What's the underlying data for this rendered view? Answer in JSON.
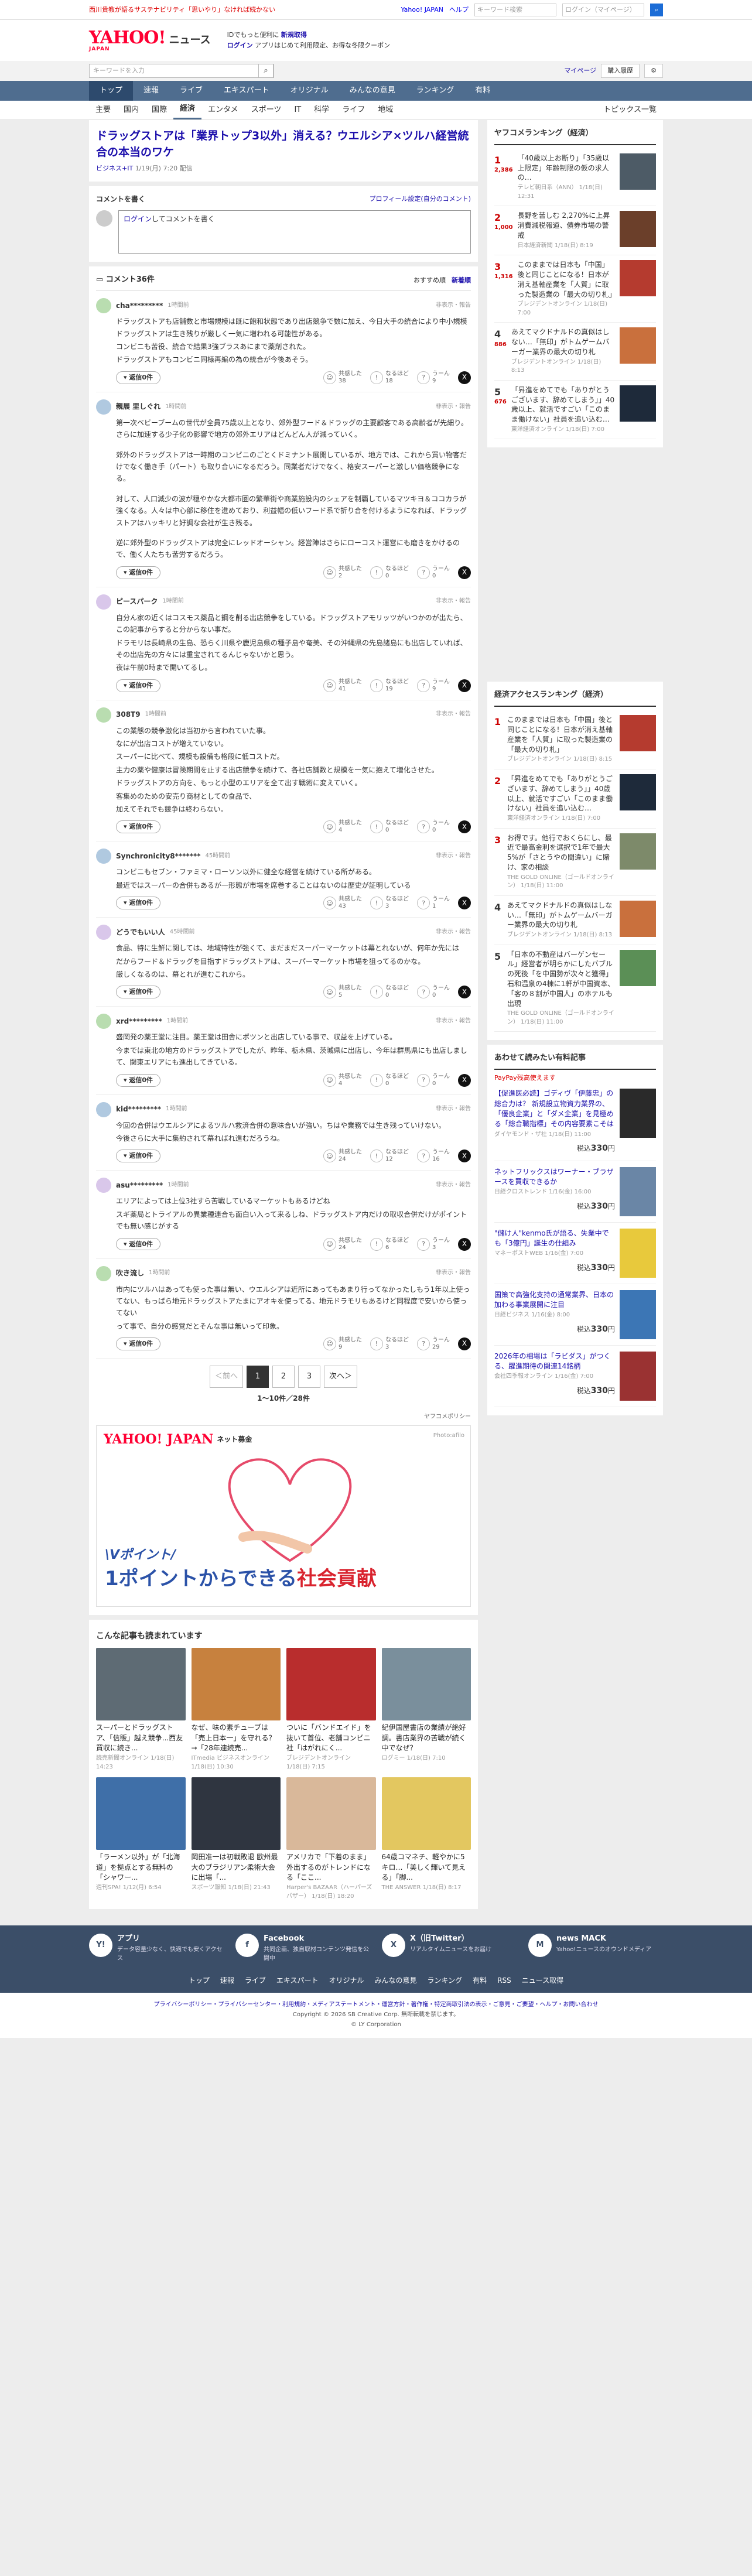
{
  "top": {
    "promo": "西川貴教が語るサステナビリティ「思いやり」なければ続かない",
    "jp": "Yahoo! JAPAN",
    "help": "ヘルプ",
    "search": "キーワード検索",
    "cw": "ログイン（マイページ）"
  },
  "header": {
    "logo": "YAHOO!",
    "logo_sub": "JAPAN",
    "news": "ニュース",
    "l1": "IDでもっと便利に",
    "l1b": "新規取得",
    "l2": "ログイン",
    "l2b": "アプリはじめて利用限定、お得な冬限クーポン"
  },
  "search": {
    "ph": "キーワードを入力",
    "mp": "マイページ",
    "buy": "購入履歴"
  },
  "nav1": [
    "トップ",
    "速報",
    "ライブ",
    "エキスパート",
    "オリジナル",
    "みんなの意見",
    "ランキング",
    "有料"
  ],
  "nav2": [
    "主要",
    "国内",
    "国際",
    "経済",
    "エンタメ",
    "スポーツ",
    "IT",
    "科学",
    "ライフ",
    "地域"
  ],
  "nav2_topics": "トピックス一覧",
  "article": {
    "title": "ドラッグストアは「業界トップ3以外」消える？ウエルシア×ツルハ経営統合の本当のワケ",
    "src": "ビジネス+IT",
    "date": "1/19(月) 7:20 配信"
  },
  "cwrite": {
    "h": "コメントを書く",
    "prof": "プロフィール設定(自分のコメント)",
    "login": "ログイン",
    "rest": "してコメントを書く"
  },
  "comments_h": {
    "title": "コメント36件",
    "rec": "おすすめ順",
    "new": "新着順"
  },
  "labels": {
    "reply": "返信0件",
    "report": "非表示・報告",
    "agree": "共感した",
    "insight": "なるほど",
    "doubt": "うーん"
  },
  "comments": [
    {
      "user": "cha*********",
      "time": "1時間前",
      "body": [
        "ドラッグストアも店舗数と市場規模は既に飽和状態であり出店競争で数に加え、今日大手の統合により中小規模ドラッグストアは生き残りが厳しく一気に増われる可能性がある。",
        "コンビニも苦役、統合で結果3強ブラスあにまで薬剤された。",
        "ドラッグストアもコンビニ同様再編の為の統合が今後あそう。"
      ],
      "a": "38",
      "b": "18",
      "c": "9"
    },
    {
      "user": "親展 里しぐれ",
      "time": "1時間前",
      "body": [
        "第一次ベビーブームの世代が全員75歳以上となり、郊外型フード＆ドラッグの主要顧客である高齢者が先細り。さらに加速する少子化の影響で地方の郊外エリアはどんどん人が減っていく。",
        "",
        "郊外のドラッグストアは一時期のコンビニのごとくドミナント展開しているが、地方では、これから買い物客だけでなく働き手（パート）も取り合いになるだろう。同業者だけでなく、格安スーパーと激しい価格競争になる。",
        "",
        "対して、人口減少の波が穏やかな大都市圏の繁華街や商業施設内のシェアを制覇しているマツキヨ＆ココカラが強くなる。人々は中心部に移住を進めており、利益幅の低いフード系で折り合を付けるようになれば、ドラッグストアはハッキリと好調な会社が生き残る。",
        "",
        "逆に郊外型のドラッグストアは完全にレッドオーシャン。経営陣はさらにローコスト運営にも磨きをかけるので、働く人たちも苦労するだろう。"
      ],
      "a": "2",
      "b": "0",
      "c": "0"
    },
    {
      "user": "ピースパーク",
      "time": "1時間前",
      "body": [
        "自分ん家の近くはコスモス薬品と鋼を削る出店競争をしている。ドラッグストアモリッツがいつかのが出たら、この記事からすると分からない事だ。",
        "ドラモリは長崎県の生島、恐らく川県や鹿児島県の種子島や奄美、その沖縄県の先島諸島にも出店していれば、その出店先の方々には重宝されてるんじゃないかと思う。",
        "夜は午前0時まで開いてるし。"
      ],
      "a": "41",
      "b": "19",
      "c": "9"
    },
    {
      "user": "308T9",
      "time": "1時間前",
      "body": [
        "この業態の競争激化は当初から言われていた事。",
        "なにが出店コストが増えていない。",
        "スーパーに比べて、規模も設備も格段に低コストだ。",
        "主力の薬や健康は冒険期間を止する出店競争を続けて、各社店舗数と規模を一気に抱えて増化させた。",
        "ドラッグストアの方向を、もっと小型のエリアを全て出す戦術に変えていく。",
        "客集めのための安売り商材としての食品で、",
        "加えてそれでも競争は終わらない。"
      ],
      "a": "4",
      "b": "0",
      "c": "0"
    },
    {
      "user": "Synchronicity8*******",
      "time": "45時間前",
      "body": [
        "コンビニもセブン・ファミマ・ローソン以外に健全な経営を続けている所がある。",
        "最近ではスーパーの合併もあるが一形態が市場を席巻することはないのは歴史が証明している"
      ],
      "a": "43",
      "b": "3",
      "c": "1"
    },
    {
      "user": "どうでもいい人",
      "time": "45時間前",
      "body": [
        "食品、特に生鮮に関しては、地域特性が強くて、まだまだスーパーマーケットは幕とれないが、何年か先には",
        "だからフード＆ドラッグを目指すドラッグストアは、スーパーマーケット市場を狙ってるのかな。",
        "厳しくなるのは、幕とれが進むこれから。"
      ],
      "a": "5",
      "b": "0",
      "c": "0"
    },
    {
      "user": "xrd*********",
      "time": "1時間前",
      "body": [
        "盛岡発の薬王堂に注目。薬王堂は田舎にポツンと出店している事で、収益を上げている。",
        "今までは東北の地方のドラッグストアでしたが、昨年、栃木県、茨城県に出店し、今年は群馬県にも出店しまして、関東エリアにも進出してきている。"
      ],
      "a": "4",
      "b": "0",
      "c": "0"
    },
    {
      "user": "kid*********",
      "time": "1時間前",
      "body": [
        "今回の合併はウエルシアによるツルハ救済合併の意味合いが強い。ちはや業務では生き残っていけない。",
        "今後さらに大手に集約されて幕ればれ進むだろうね。"
      ],
      "a": "24",
      "b": "12",
      "c": "16"
    },
    {
      "user": "asu*********",
      "time": "1時間前",
      "body": [
        "エリアによっては上位3社すら苦戦しているマーケットもあるけどね",
        "スギ薬局とトライアルの異業種連合も面白い入って来るしね、ドラッグストア内だけの取収合併だけがポイントでも無い感じがする"
      ],
      "a": "24",
      "b": "6",
      "c": "3"
    },
    {
      "user": "吹き流し",
      "time": "1時間前",
      "body": [
        "市内にツルハはあっても使った事は無い、ウエルシアは近所にあってもあまり行ってなかったしもう1年以上使ってない、もっぱら地元ドラッグストアたまにアオキを使ってる、地元ドラモリもあるけど同程度で安いから使ってない",
        "って事で、自分の感覚だとそんな事は無いって印象。"
      ],
      "a": "9",
      "b": "3",
      "c": "29"
    }
  ],
  "pager": {
    "prev": "＜前へ",
    "p": [
      "1",
      "2",
      "3"
    ],
    "next": "次へ＞",
    "count": "1〜10件／28件"
  },
  "sponsor": "ヤフコメポリシー",
  "ad": {
    "logo": "YAHOO! JAPAN",
    "sub": "ネット募金",
    "photo": "Photo:afilo",
    "t1": "\\Vポイント/",
    "t2a": "1ポイントからできる",
    "t2b": "社会貢献"
  },
  "related": {
    "h": "こんな記事も読まれています",
    "items": [
      {
        "t": "スーパーとドラッグストア、「信販」越え競争...西友買収に続き...",
        "s": "読売新聞オンライン 1/18(日) 14:23",
        "c": "#5e6b74"
      },
      {
        "t": "なぜ、味の素チューブは「売上日本一」を守れる？→「28年連続売...",
        "s": "ITmedia ビジネスオンライン 1/18(日) 10:30",
        "c": "#c7813e"
      },
      {
        "t": "ついに「バンドエイド」を抜いて首位、老舗コンビニ社「はがれにく...",
        "s": "ブレジデントオンライン 1/18(日) 7:15",
        "c": "#b92d2d"
      },
      {
        "t": "紀伊国屋書店の業績が絶好調。書店業界の苦戦が続く中でなぜ？",
        "s": "ログミー 1/18(日) 7:10",
        "c": "#7a8f9c"
      },
      {
        "t": "「ラーメン以外」が「北海道」を拠点とする無料の「シャワー...",
        "s": "週刊SPA! 1/12(月) 6:54",
        "c": "#3f6fa8"
      },
      {
        "t": "岡田准一は初戦敗退 欧州最大のブラジリアン柔術大会に出場「...",
        "s": "スポーツ報知 1/18(日) 21:43",
        "c": "#2f3540"
      },
      {
        "t": "アメリカで「下着のまま」外出するのがトレンドになる「ここ...",
        "s": "Harper's BAZAAR（ハーパーズ バザー） 1/18(日) 18:20",
        "c": "#d9b89a"
      },
      {
        "t": "64歳コマネチ、軽やかに5キロ…「美しく輝いて見える」「脚...",
        "s": "THE ANSWER 1/18(日) 8:17",
        "c": "#e3c760"
      }
    ]
  },
  "ranking": {
    "h": "ヤフコメランキング（経済）",
    "items": [
      {
        "n": "1",
        "t": "「40歳以上お断り」「35歳以上限定」年齢制限の仮の求人の…",
        "s": "テレビ朝日系（ANN） 1/18(日) 12:31",
        "pc": "2,386",
        "c": "#4d5b66"
      },
      {
        "n": "2",
        "t": "長野を苦しむ 2,270%に上昇 消費減税報道、債券市場の警戒",
        "s": "日本経済新聞 1/18(日) 8:19",
        "pc": "1,000",
        "c": "#6b3f2a"
      },
      {
        "n": "3",
        "t": "このままでは日本も「中国」後と同じことになる！日本が消え基軸産業を「人質」に取った製造業の「最大の切り札」",
        "s": "ブレジデントオンライン 1/18(日) 7:00",
        "pc": "1,316",
        "c": "#b53b2f"
      },
      {
        "n": "4",
        "t": "あえてマクドナルドの真似はしない…「無印」がトムゲームバーガー業界の最大の切り札",
        "s": "ブレジデントオンライン 1/18(日) 8:13",
        "pc": "886",
        "c": "#c9703d"
      },
      {
        "n": "5",
        "t": "「昇進をめてでも「ありがとうございます、辞めてしまう」」40歳以上、就活ですごい「このまま働けない」社員を追い込む…",
        "s": "東洋経済オンライン 1/18(日) 7:00",
        "pc": "676",
        "c": "#1e2a3a"
      }
    ]
  },
  "access": {
    "h": "経済アクセスランキング（経済）",
    "items": [
      {
        "n": "1",
        "t": "このままでは日本も「中国」後と同じことになる！日本が消え基軸産業を「人質」に取った製造業の「最大の切り札」",
        "s": "ブレジデントオンライン 1/18(日) 8:15",
        "c": "#b53b2f"
      },
      {
        "n": "2",
        "t": "「昇進をめてでも「ありがとうございます、辞めてしまう」」40歳以上、就活ですごい「このまま働けない」社員を追い込む…",
        "s": "東洋経済オンライン 1/18(日) 7:00",
        "c": "#1e2a3a"
      },
      {
        "n": "3",
        "t": "お得です。他行でおくらにし、最近で最高金利を選択で1年で最大5%が「さとうやの間違い」に賭け、家の相談",
        "s": "THE GOLD ONLINE（ゴールドオンライン） 1/18(日) 11:00",
        "c": "#7d8a6a"
      },
      {
        "n": "4",
        "t": "あえてマクドナルドの真似はしない…「無印」がトムゲームバーガー業界の最大の切り札",
        "s": "ブレジデントオンライン 1/18(日) 8:13",
        "c": "#c9703d"
      },
      {
        "n": "5",
        "t": "「日本の不動産はバーゲンセール」経営者が明らかにしたバブルの死後「を中国勢が次々と獲得」石和温泉の4棟に1軒が中国資本、「客の８割が中国人」のホテルも出現",
        "s": "THE GOLD ONLINE（ゴールドオンライン） 1/18(日) 11:00",
        "c": "#5b8f56"
      }
    ]
  },
  "magazine": {
    "h": "あわせて読みたい有料記事",
    "sub": "PayPay残高使えます",
    "items": [
      {
        "t": "【促進医必読】ゴディヴ「伊藤忠」の総合力は？ 新規設立物資力業界の、「優良企業」と「ダメ企業」を見極める「総合職指標」その内容要素こそは",
        "s": "ダイヤモンド・ザ社 1/18(日) 11:00",
        "p": "330",
        "c": "#2a2a2a"
      },
      {
        "t": "ネットフリックスはワーナー・ブラザースを買収できるか",
        "s": "日経クロストレンド 1/16(金) 16:00",
        "p": "330",
        "c": "#6a86a6"
      },
      {
        "t": "\"儲け人\"kenmo氏が語る、失業中でも「3億円」誕生の仕組み",
        "s": "マネーポストWEB 1/16(金) 7:00",
        "p": "330",
        "c": "#e8c93c"
      },
      {
        "t": "国策で高強化支持の通常業界、日本の加わる事業展開に注目",
        "s": "日経ビジネス 1/16(金) 8:00",
        "p": "330",
        "c": "#3c76b5"
      },
      {
        "t": "2026年の相場は「ラビダス」がつくる、躍進期待の関連14銘柄",
        "s": "会社四季報オンライン 1/16(金) 7:00",
        "p": "330",
        "c": "#9a3232"
      }
    ]
  },
  "price_unit": "円",
  "price_prefix": "税込",
  "footer": {
    "cols": [
      {
        "h": "アプリ",
        "d": "データ容量少なく、快適でも安くアクセス",
        "i": "Y!"
      },
      {
        "h": "Facebook",
        "d": "共同企画、独自取材コンテンツ発信を公開中",
        "i": "f"
      },
      {
        "h": "X（旧Twitter）",
        "d": "リアルタイムニュースをお届け",
        "i": "X"
      },
      {
        "h": "news MACK",
        "d": "Yahoo!ニュースのオウンドメディア",
        "i": "M"
      }
    ],
    "nav": [
      "トップ",
      "速報",
      "ライブ",
      "エキスパート",
      "オリジナル",
      "みんなの意見",
      "ランキング",
      "有料",
      "RSS",
      "ニュース取得"
    ],
    "links": "プライバシーポリシー・プライバシーセンター・利用規約・メディアステートメント・運営方針・著作権・特定商取引法の表示・ご意見・ご要望・ヘルプ・お問い合わせ",
    "copy": "Copyright © 2026 SB Creative Corp. 無断転載を禁じます。",
    "copy2": "© LY Corporation"
  }
}
